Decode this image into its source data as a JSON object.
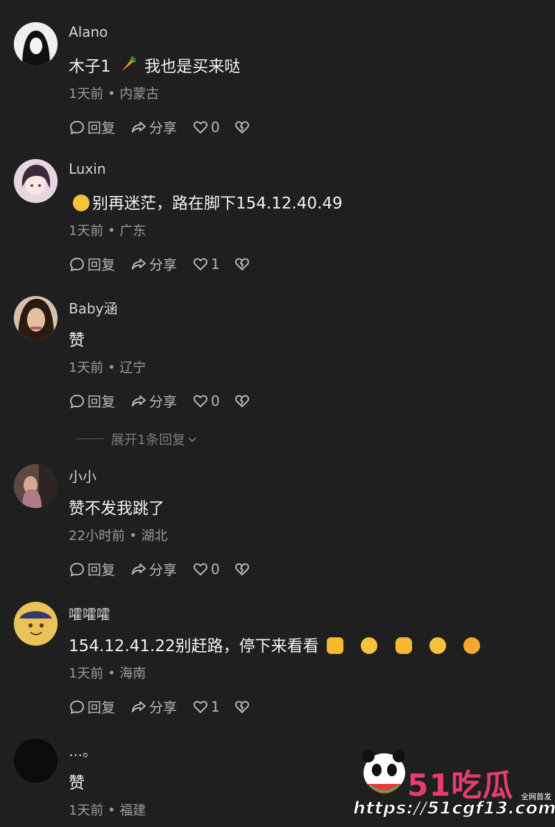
{
  "comments": [
    {
      "username": "Alano",
      "content_prefix": "木子1",
      "content_suffix": "我也是买来哒",
      "time": "1天前",
      "location": "内蒙古",
      "reply": "回复",
      "share": "分享",
      "likes": "0"
    },
    {
      "username": "Luxin",
      "content": "别再迷茫，路在脚下154.12.40.49",
      "time": "1天前",
      "location": "广东",
      "reply": "回复",
      "share": "分享",
      "likes": "1"
    },
    {
      "username": "Baby涵",
      "content": "赞",
      "time": "1天前",
      "location": "辽宁",
      "reply": "回复",
      "share": "分享",
      "likes": "0"
    },
    {
      "username": "小小",
      "content": "赞不发我跳了",
      "time": "22小时前",
      "location": "湖北",
      "reply": "回复",
      "share": "分享",
      "likes": "0"
    },
    {
      "username": "嚯嚯嚯",
      "content": "154.12.41.22别赶路，停下来看看",
      "time": "1天前",
      "location": "海南",
      "reply": "回复",
      "share": "分享",
      "likes": "1"
    },
    {
      "username": "…。",
      "content": "赞",
      "time": "1天前",
      "location": "福建"
    }
  ],
  "expand_replies": "展开1条回复",
  "meta_separator": " • ",
  "watermark": {
    "brand": "51吃瓜",
    "tag": "全网首发",
    "url": "https://51cgf13.com"
  },
  "colors": {
    "background": "#1f1f1f",
    "text": "#f2f2f2",
    "meta": "#9a9a9a",
    "brand": "#e63c6e"
  }
}
